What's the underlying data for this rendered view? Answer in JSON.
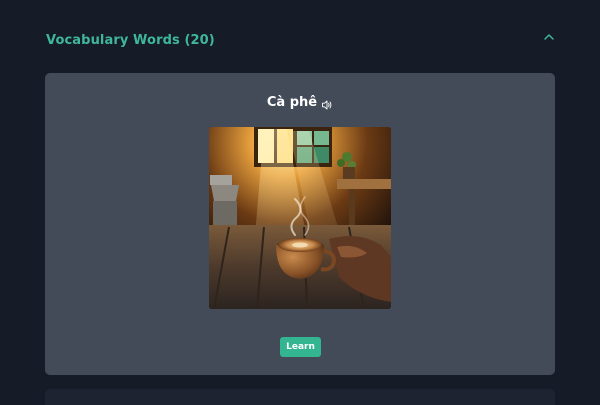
{
  "section": {
    "title": "Vocabulary Words (20)",
    "collapse_icon": "chevron-up-icon"
  },
  "card": {
    "word": "Cà phê",
    "audio_icon": "speaker-icon",
    "image_subject": "coffee cup",
    "learn_label": "Learn"
  },
  "colors": {
    "background": "#151b27",
    "accent": "#3fb79a",
    "card": "#434b58",
    "button": "#33b592"
  }
}
